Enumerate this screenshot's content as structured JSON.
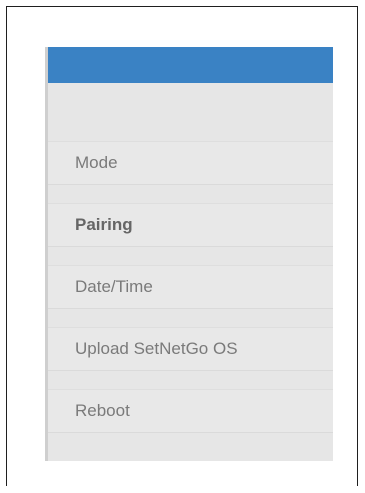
{
  "sidebar": {
    "header_color": "#3a82c4",
    "items": [
      {
        "label": "Mode",
        "active": false
      },
      {
        "label": "Pairing",
        "active": true
      },
      {
        "label": "Date/Time",
        "active": false
      },
      {
        "label": "Upload SetNetGo OS",
        "active": false
      },
      {
        "label": "Reboot",
        "active": false
      }
    ]
  }
}
